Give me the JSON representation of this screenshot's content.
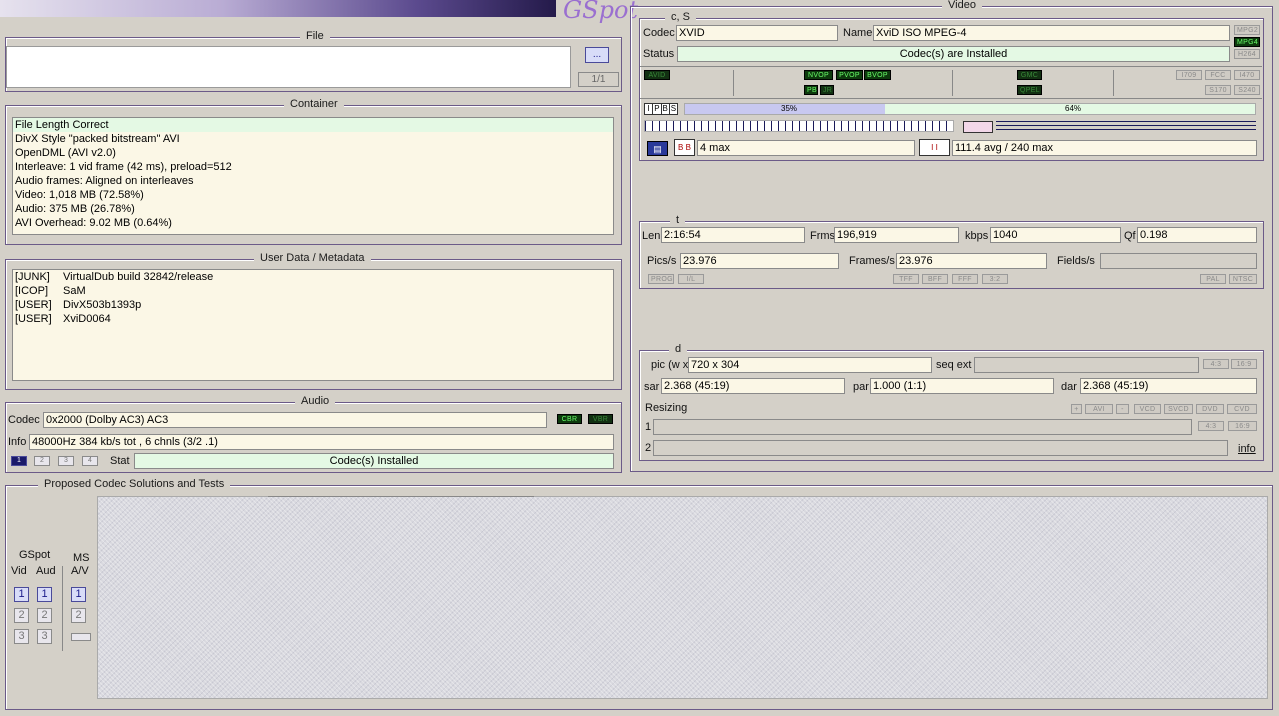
{
  "brand": {
    "logo_text": "GSpot"
  },
  "file": {
    "title": "File",
    "browse_label": "...",
    "page_indicator": "1/1",
    "path_value": ""
  },
  "container": {
    "title": "Container",
    "lines": [
      "File Length Correct",
      "DivX Style \"packed bitstream\" AVI",
      "OpenDML (AVI v2.0)",
      "Interleave: 1 vid frame (42 ms), preload=512",
      "Audio frames: Aligned on interleaves",
      "Video: 1,018 MB (72.58%)",
      "Audio: 375 MB (26.78%)",
      "AVI Overhead: 9.02 MB (0.64%)"
    ]
  },
  "userdata": {
    "title": "User Data / Metadata",
    "rows": [
      {
        "tag": "[JUNK]",
        "value": "VirtualDub build 32842/release"
      },
      {
        "tag": "[ICOP]",
        "value": "SaM"
      },
      {
        "tag": "[USER]",
        "value": "DivX503b1393p"
      },
      {
        "tag": "[USER]",
        "value": "XviD0064"
      }
    ]
  },
  "audio": {
    "title": "Audio",
    "codec_label": "Codec",
    "codec_value": "0x2000 (Dolby AC3) AC3",
    "cbr_label": "CBR",
    "vbr_label": "VBR",
    "info_label": "Info",
    "info_value": "48000Hz  384 kb/s tot , 6 chnls (3/2 .1)",
    "streams": [
      "1",
      "2",
      "3",
      "4"
    ],
    "stat_label": "Stat",
    "stat_value": "Codec(s) Installed"
  },
  "proposed": {
    "title": "Proposed Codec Solutions and Tests",
    "gspot_label": "GSpot",
    "vid_label": "Vid",
    "aud_label": "Aud",
    "ms_label": "MS",
    "av_label": "A/V",
    "vid_buttons": [
      "1",
      "2",
      "3"
    ],
    "aud_buttons": [
      "1",
      "2",
      "3"
    ],
    "ms_buttons": [
      "1",
      "2"
    ]
  },
  "video": {
    "title": "Video",
    "cs_title": "c, S",
    "codec_label": "Codec",
    "codec_value": "XVID",
    "name_label": "Name",
    "name_value": "XviD ISO MPEG-4",
    "status_label": "Status",
    "status_value": "Codec(s) are Installed",
    "side_flags": [
      "MPG2",
      "MPG4",
      "H264"
    ],
    "flags_row1_left": "AVID",
    "flags_vop": [
      "NVOP",
      "PVOP",
      "BVOP"
    ],
    "flags_vop2": [
      "PB",
      "JR"
    ],
    "flags_mid": [
      "GMC",
      "QPEL"
    ],
    "flags_right1": [
      "I709",
      "FCC",
      "I470"
    ],
    "flags_right2": [
      "S170",
      "S240"
    ],
    "frame_types": [
      "I",
      "P",
      "B",
      "S"
    ],
    "bar_left_pct": "35%",
    "bar_right_pct": "64%",
    "bar_left_fraction": 0.35,
    "bframes_value": "4 max",
    "bitrate_value": "111.4 avg / 240 max"
  },
  "timing": {
    "title": "t",
    "len_label": "Len",
    "len_value": "2:16:54",
    "frms_label": "Frms",
    "frms_value": "196,919",
    "kbps_label": "kbps",
    "kbps_value": "1040",
    "qf_label": "Qf",
    "qf_value": "0.198",
    "pics_label": "Pics/s",
    "pics_value": "23.976",
    "frames_label": "Frames/s",
    "frames_value": "23.976",
    "fields_label": "Fields/s",
    "fields_value": "",
    "flags_left": [
      "PROG",
      "I/L"
    ],
    "flags_mid": [
      "TFF",
      "BFF",
      "FFF",
      "3:2"
    ],
    "flags_right": [
      "PAL",
      "NTSC"
    ]
  },
  "dims": {
    "title": "d",
    "pic_label": "pic (w x",
    "pic_value": "720 x 304",
    "seq_label": "seq ext",
    "seq_value": "",
    "ratio_flags": [
      "4:3",
      "16:9"
    ],
    "sar_label": "sar",
    "sar_value": "2.368 (45:19)",
    "par_label": "par",
    "par_value": "1.000 (1:1)",
    "dar_label": "dar",
    "dar_value": "2.368 (45:19)",
    "resizing_label": "Resizing",
    "resize_buttons": [
      "+",
      "AVI",
      "-",
      "VCD",
      "SVCD",
      "DVD",
      "CVD"
    ],
    "row1_label": "1",
    "row2_label": "2",
    "row1_flags": [
      "4:3",
      "16:9"
    ],
    "info_link": "info"
  }
}
